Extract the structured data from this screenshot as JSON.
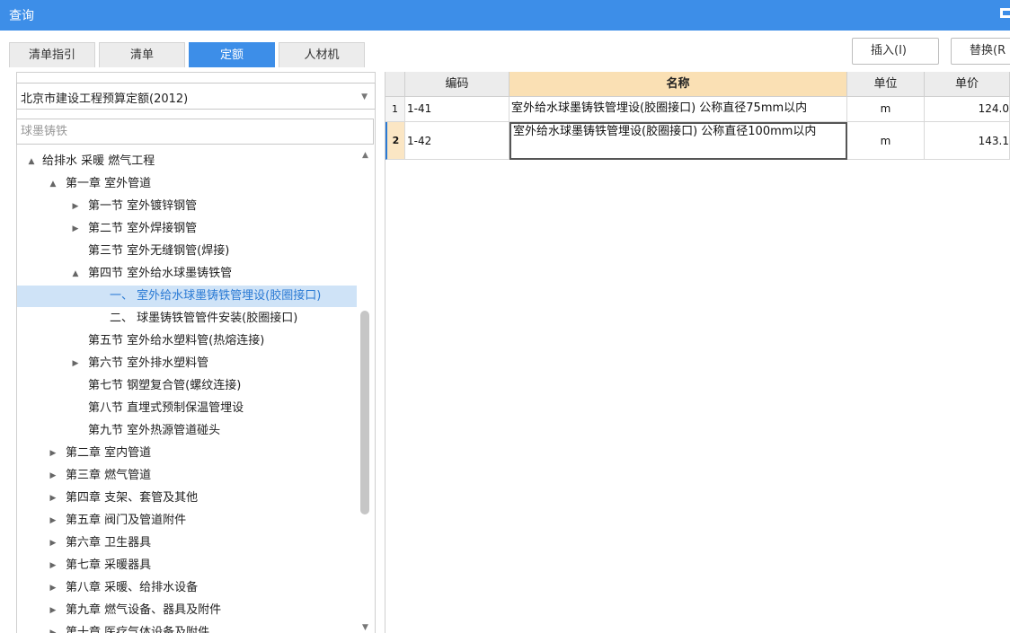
{
  "window": {
    "title": "查询"
  },
  "tabs": [
    "清单指引",
    "清单",
    "定额",
    "人材机"
  ],
  "toolbar": {
    "insert_label": "插入(I)",
    "replace_label": "替换(R"
  },
  "quota_select": {
    "value": "北京市建设工程预算定额(2012)"
  },
  "search": {
    "value": "",
    "placeholder": "球墨铸铁"
  },
  "tree": [
    {
      "label": "给排水 采暖 燃气工程",
      "toggle": "▲"
    },
    {
      "label": "第一章 室外管道",
      "toggle": "▲"
    },
    {
      "label": "第一节 室外镀锌钢管",
      "toggle": "▶"
    },
    {
      "label": "第二节 室外焊接钢管",
      "toggle": "▶"
    },
    {
      "label": "第三节 室外无缝钢管(焊接)",
      "toggle": ""
    },
    {
      "label": "第四节 室外给水球墨铸铁管",
      "toggle": "▲"
    },
    {
      "label": "一、 室外给水球墨铸铁管埋设(胶圈接口)",
      "toggle": ""
    },
    {
      "label": "二、 球墨铸铁管管件安装(胶圈接口)",
      "toggle": ""
    },
    {
      "label": "第五节 室外给水塑料管(热熔连接)",
      "toggle": ""
    },
    {
      "label": "第六节 室外排水塑料管",
      "toggle": "▶"
    },
    {
      "label": "第七节 钢塑复合管(螺纹连接)",
      "toggle": ""
    },
    {
      "label": "第八节 直埋式预制保温管埋设",
      "toggle": ""
    },
    {
      "label": "第九节 室外热源管道碰头",
      "toggle": ""
    },
    {
      "label": "第二章 室内管道",
      "toggle": "▶"
    },
    {
      "label": "第三章 燃气管道",
      "toggle": "▶"
    },
    {
      "label": "第四章 支架、套管及其他",
      "toggle": "▶"
    },
    {
      "label": "第五章 阀门及管道附件",
      "toggle": "▶"
    },
    {
      "label": "第六章 卫生器具",
      "toggle": "▶"
    },
    {
      "label": "第七章 采暖器具",
      "toggle": "▶"
    },
    {
      "label": "第八章 采暖、给排水设备",
      "toggle": "▶"
    },
    {
      "label": "第九章 燃气设备、器具及附件",
      "toggle": "▶"
    },
    {
      "label": "第十章 医疗气体设备及附件",
      "toggle": "▶"
    }
  ],
  "scrollbar": {
    "up": "▲",
    "down": "▼"
  },
  "table": {
    "headers": [
      "编码",
      "名称",
      "单位",
      "单价"
    ],
    "rows": [
      {
        "num": "1",
        "code": "1-41",
        "name": "室外给水球墨铸铁管埋设(胶圈接口) 公称直径75mm以内",
        "unit": "m",
        "price": "124.0"
      },
      {
        "num": "2",
        "code": "1-42",
        "name": "室外给水球墨铸铁管埋设(胶圈接口) 公称直径100mm以内",
        "unit": "m",
        "price": "143.1"
      }
    ]
  },
  "colors": {
    "accent": "#3d8ee8",
    "selected_row": "#cfe3f7",
    "sorted_header": "#fae0b4"
  }
}
